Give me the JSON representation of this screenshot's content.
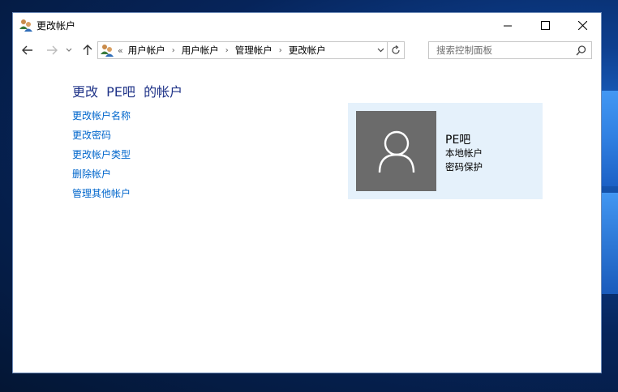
{
  "window": {
    "title": "更改帐户",
    "controls": {
      "minimize": "minimize-icon",
      "maximize": "maximize-icon",
      "close": "close-icon"
    }
  },
  "nav": {
    "back_icon": "back-arrow-icon",
    "forward_icon": "forward-arrow-icon",
    "recent_icon": "chevron-down-icon",
    "up_icon": "up-arrow-icon"
  },
  "address": {
    "overflow": "«",
    "crumbs": [
      "用户帐户",
      "用户帐户",
      "管理帐户",
      "更改帐户"
    ],
    "separator": "›"
  },
  "search": {
    "placeholder": "搜索控制面板",
    "value": ""
  },
  "main": {
    "title": "更改  PE吧  的帐户",
    "tasks": [
      "更改帐户名称",
      "更改密码",
      "更改帐户类型",
      "删除帐户"
    ],
    "other_task": "管理其他帐户"
  },
  "account": {
    "name": "PE吧",
    "type": "本地帐户",
    "password_status": "密码保护",
    "avatar_icon": "user-avatar-icon"
  },
  "colors": {
    "title_blue": "#1e3287",
    "link_blue": "#0066cc",
    "card_bg": "#e5f1fb",
    "avatar_bg": "#6b6b6b"
  }
}
